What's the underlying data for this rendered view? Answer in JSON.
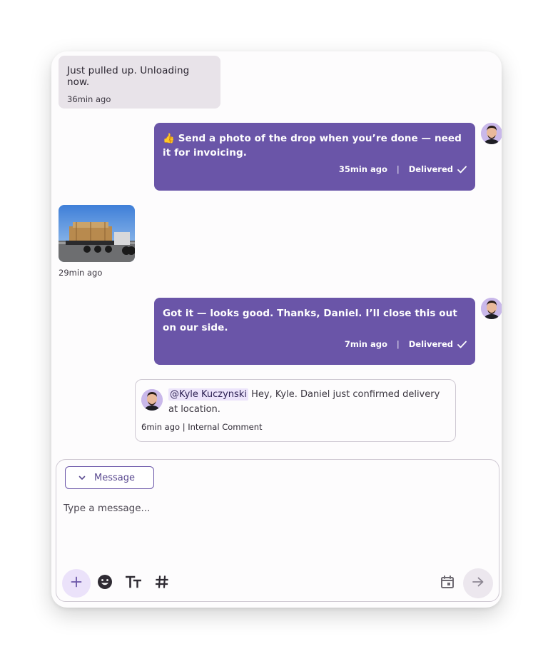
{
  "messages": {
    "incoming_text": "Just pulled up. Unloading now.",
    "incoming_time": "36min ago",
    "outgoing_1": {
      "text": "👍 Send a photo of the drop when you’re done — need it for invoicing.",
      "time": "35min ago",
      "separator": "|",
      "status": "Delivered"
    },
    "photo_time": "29min ago",
    "outgoing_2": {
      "text": "Got it — looks good. Thanks, Daniel. I’ll close this out on our side.",
      "time": "7min ago",
      "separator": "|",
      "status": "Delivered"
    }
  },
  "internal_comment": {
    "mention": "@Kyle Kuczynski",
    "text": " Hey, Kyle. Daniel just confirmed delivery at location.",
    "meta": "6min ago | Internal Comment"
  },
  "composer": {
    "channel_label": "Message",
    "placeholder": "Type a message..."
  },
  "colors": {
    "outgoing_bubble": "#6a55a8",
    "incoming_bubble": "#e8e3e9",
    "accent": "#6a55a8",
    "mention_bg": "#ece4fb"
  },
  "icons": {
    "delivered": "check-icon",
    "channel": "chevron-down-icon",
    "add": "plus-icon",
    "emoji": "emoji-icon",
    "text_format": "text-format-icon",
    "hashtag": "hashtag-icon",
    "schedule": "calendar-icon",
    "send": "arrow-right-icon"
  }
}
